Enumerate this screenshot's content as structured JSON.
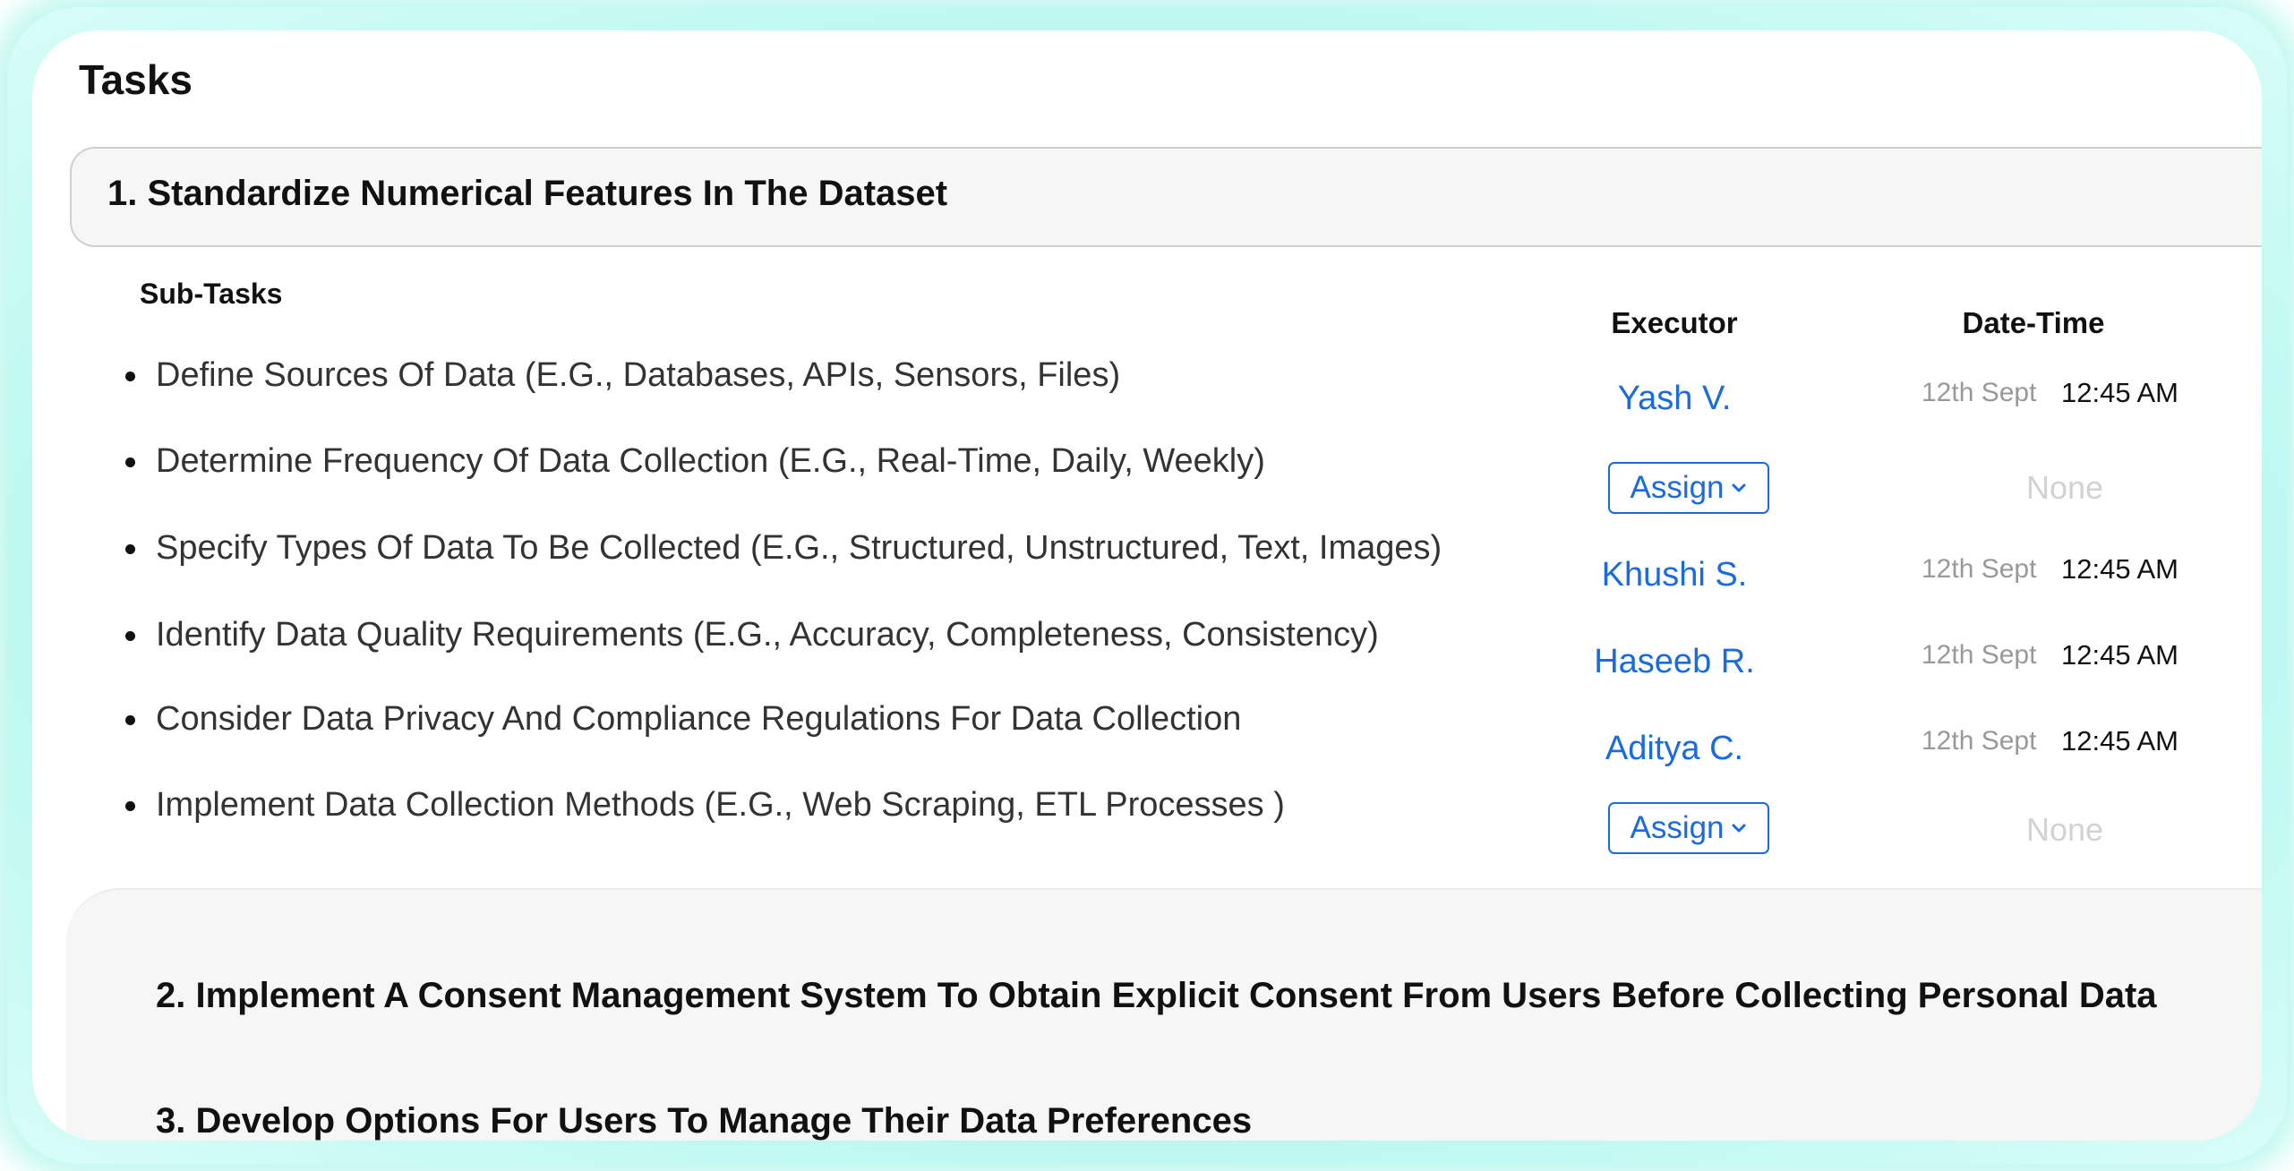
{
  "page": {
    "title": "Tasks"
  },
  "tasks": [
    {
      "title": "1. Standardize Numerical Features In The Dataset"
    },
    {
      "title": "2. Implement A Consent Management System To Obtain Explicit Consent From Users Before Collecting Personal Data"
    },
    {
      "title": "3. Develop Options For Users To Manage Their Data Preferences"
    }
  ],
  "subtasks": {
    "heading": "Sub-Tasks",
    "columns": {
      "executor": "Executor",
      "datetime": "Date-Time"
    },
    "items": [
      {
        "text": "Define Sources Of Data (E.G., Databases, APIs, Sensors, Files)",
        "executor": "Yash V.",
        "date": "12th Sept",
        "time": "12:45 AM"
      },
      {
        "text": "Determine Frequency Of Data Collection (E.G., Real-Time, Daily, Weekly)",
        "assign_label": "Assign",
        "none_label": "None"
      },
      {
        "text": "Specify Types Of Data To Be Collected (E.G., Structured, Unstructured, Text, Images)",
        "executor": "Khushi S.",
        "date": "12th Sept",
        "time": "12:45 AM"
      },
      {
        "text": "Identify Data Quality Requirements (E.G., Accuracy, Completeness, Consistency)",
        "executor": "Haseeb R.",
        "date": "12th Sept",
        "time": "12:45 AM"
      },
      {
        "text": "Consider Data Privacy And Compliance Regulations For Data Collection",
        "executor": "Aditya C.",
        "date": "12th Sept",
        "time": "12:45 AM"
      },
      {
        "text": "Implement Data Collection Methods (E.G., Web Scraping, ETL Processes )",
        "assign_label": "Assign",
        "none_label": "None"
      }
    ]
  },
  "colors": {
    "accent": "#1a6ae0",
    "glow": "#b5f7ee",
    "muted": "#999999",
    "none": "#d2d2d2"
  },
  "icons": {
    "assign_dropdown": "chevron-down-icon",
    "list_bullet": "bullet-icon"
  }
}
